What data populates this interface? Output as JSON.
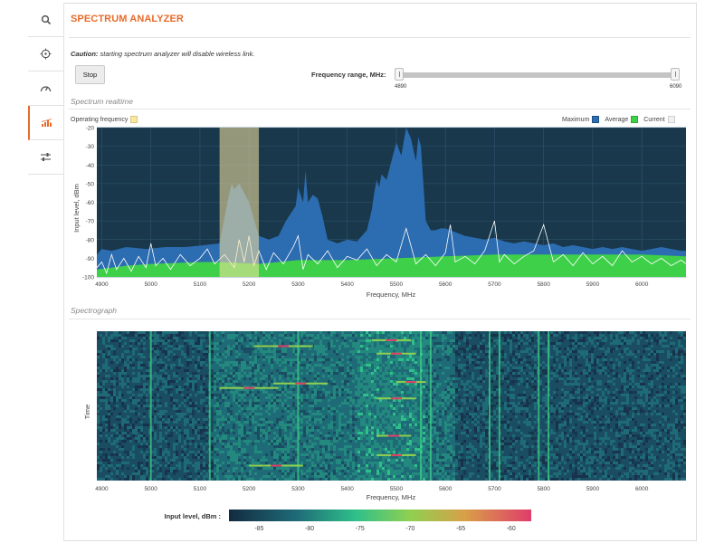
{
  "panel": {
    "title": "SPECTRUM ANALYZER",
    "caution_label": "Caution:",
    "caution_text": " starting spectrum analyzer will disable wireless link.",
    "stop_label": "Stop",
    "frequency_range_label": "Frequency range, MHz:",
    "range_min": "4890",
    "range_max": "6090",
    "range_selected": [
      4890,
      6090
    ]
  },
  "sidebar": {
    "items": [
      {
        "icon": "search-icon",
        "active": false
      },
      {
        "icon": "crosshair-icon",
        "active": false
      },
      {
        "icon": "gauge-icon",
        "active": false
      },
      {
        "icon": "spectrum-icon",
        "active": true
      },
      {
        "icon": "sliders-icon",
        "active": false
      }
    ]
  },
  "realtime": {
    "section_title": "Spectrum realtime",
    "legend_operating": "Operating frequency",
    "legend_maximum": "Maximum",
    "legend_average": "Average",
    "legend_current": "Current"
  },
  "spectrograph": {
    "section_title": "Spectrograph",
    "colorbar_label": "Input level, dBm :",
    "colorbar_ticks": [
      "-85",
      "-80",
      "-75",
      "-70",
      "-65",
      "-60"
    ]
  },
  "colors": {
    "accent": "#e86b2a",
    "plot_background": "#19384c",
    "maximum": "#2c6cb0",
    "average": "#3fd04a",
    "current": "#ffffff",
    "operating": "#f9e6a0"
  },
  "chart_data": [
    {
      "type": "area",
      "xlabel": "Frequency, MHz",
      "ylabel": "Input level, dBm",
      "xlim": [
        4890,
        6090
      ],
      "ylim": [
        -100,
        -20
      ],
      "x_ticks": [
        "4900",
        "5000",
        "5100",
        "5200",
        "5300",
        "5400",
        "5500",
        "5600",
        "5700",
        "5800",
        "5900",
        "6000"
      ],
      "y_ticks": [
        "-20",
        "-30",
        "-40",
        "-50",
        "-60",
        "-70",
        "-80",
        "-90",
        "-100"
      ],
      "operating_band": [
        5140,
        5220
      ],
      "legend_position": "top-right",
      "grid": true,
      "series": [
        {
          "name": "Maximum",
          "x": [
            4890,
            4900,
            4920,
            4950,
            4990,
            5030,
            5070,
            5110,
            5140,
            5150,
            5160,
            5165,
            5170,
            5180,
            5190,
            5200,
            5220,
            5240,
            5260,
            5275,
            5285,
            5295,
            5300,
            5310,
            5315,
            5320,
            5330,
            5340,
            5350,
            5360,
            5380,
            5400,
            5420,
            5440,
            5450,
            5455,
            5460,
            5465,
            5470,
            5480,
            5490,
            5500,
            5510,
            5520,
            5530,
            5540,
            5545,
            5550,
            5560,
            5570,
            5580,
            5590,
            5600,
            5620,
            5640,
            5660,
            5680,
            5700,
            5720,
            5740,
            5760,
            5780,
            5800,
            5820,
            5840,
            5860,
            5880,
            5900,
            5920,
            5940,
            5960,
            5980,
            6000,
            6020,
            6040,
            6060,
            6080,
            6090
          ],
          "values": [
            -88,
            -85,
            -86,
            -84,
            -85,
            -84,
            -84,
            -83,
            -82,
            -68,
            -55,
            -50,
            -53,
            -50,
            -55,
            -60,
            -78,
            -80,
            -78,
            -70,
            -66,
            -62,
            -52,
            -60,
            -43,
            -60,
            -56,
            -58,
            -68,
            -80,
            -82,
            -80,
            -81,
            -75,
            -64,
            -55,
            -48,
            -52,
            -45,
            -48,
            -38,
            -28,
            -35,
            -20,
            -26,
            -38,
            -25,
            -30,
            -70,
            -75,
            -75,
            -74,
            -74,
            -76,
            -78,
            -79,
            -80,
            -79,
            -81,
            -82,
            -81,
            -82,
            -83,
            -82,
            -84,
            -83,
            -84,
            -85,
            -84,
            -85,
            -84,
            -85,
            -86,
            -85,
            -84,
            -85,
            -86,
            -86
          ]
        },
        {
          "name": "Average",
          "x": [
            4890,
            4950,
            5000,
            5100,
            5140,
            5220,
            5300,
            5400,
            5500,
            5600,
            5700,
            5800,
            5900,
            6000,
            6090
          ],
          "values": [
            -96,
            -94,
            -93,
            -92,
            -92,
            -93,
            -91,
            -91,
            -90,
            -89,
            -88,
            -88,
            -88,
            -88,
            -89
          ]
        },
        {
          "name": "Current",
          "x": [
            4890,
            4900,
            4910,
            4920,
            4930,
            4945,
            4960,
            4975,
            4990,
            5000,
            5010,
            5025,
            5040,
            5060,
            5080,
            5100,
            5115,
            5130,
            5150,
            5170,
            5180,
            5190,
            5200,
            5210,
            5220,
            5235,
            5250,
            5270,
            5290,
            5300,
            5310,
            5320,
            5340,
            5360,
            5380,
            5400,
            5420,
            5440,
            5460,
            5480,
            5500,
            5520,
            5540,
            5560,
            5580,
            5600,
            5610,
            5620,
            5640,
            5660,
            5680,
            5700,
            5710,
            5720,
            5740,
            5760,
            5780,
            5800,
            5820,
            5840,
            5860,
            5880,
            5900,
            5920,
            5940,
            5960,
            5980,
            6000,
            6020,
            6040,
            6060,
            6080,
            6090
          ],
          "values": [
            -95,
            -92,
            -98,
            -88,
            -96,
            -90,
            -97,
            -89,
            -95,
            -82,
            -94,
            -90,
            -96,
            -88,
            -94,
            -90,
            -85,
            -93,
            -88,
            -95,
            -80,
            -92,
            -78,
            -94,
            -86,
            -96,
            -87,
            -93,
            -84,
            -78,
            -96,
            -88,
            -93,
            -86,
            -95,
            -89,
            -91,
            -85,
            -94,
            -88,
            -92,
            -74,
            -93,
            -88,
            -94,
            -87,
            -72,
            -92,
            -89,
            -93,
            -86,
            -70,
            -92,
            -88,
            -93,
            -89,
            -86,
            -72,
            -92,
            -88,
            -94,
            -87,
            -93,
            -89,
            -94,
            -86,
            -92,
            -89,
            -93,
            -90,
            -94,
            -91,
            -93
          ]
        }
      ]
    },
    {
      "type": "heatmap",
      "xlabel": "Frequency, MHz",
      "ylabel": "Time",
      "xlim": [
        4890,
        6090
      ],
      "x_ticks": [
        "4900",
        "5000",
        "5100",
        "5200",
        "5300",
        "5400",
        "5500",
        "5600",
        "5700",
        "5800",
        "5900",
        "6000"
      ],
      "color_scale": {
        "min": -88,
        "max": -58,
        "unit": "dBm"
      },
      "bright_columns_mhz": [
        5000,
        5120,
        5300,
        5550,
        5570,
        5690,
        5710,
        5790,
        5810
      ],
      "interference_bursts_mhz": [
        {
          "from": 5210,
          "to": 5330,
          "row_fraction": 0.1
        },
        {
          "from": 5450,
          "to": 5530,
          "row_fraction": 0.06
        },
        {
          "from": 5460,
          "to": 5540,
          "row_fraction": 0.15
        },
        {
          "from": 5140,
          "to": 5260,
          "row_fraction": 0.38
        },
        {
          "from": 5250,
          "to": 5360,
          "row_fraction": 0.35
        },
        {
          "from": 5460,
          "to": 5540,
          "row_fraction": 0.45
        },
        {
          "from": 5500,
          "to": 5560,
          "row_fraction": 0.34
        },
        {
          "from": 5460,
          "to": 5530,
          "row_fraction": 0.7
        },
        {
          "from": 5200,
          "to": 5310,
          "row_fraction": 0.9
        },
        {
          "from": 5460,
          "to": 5540,
          "row_fraction": 0.83
        }
      ]
    }
  ]
}
